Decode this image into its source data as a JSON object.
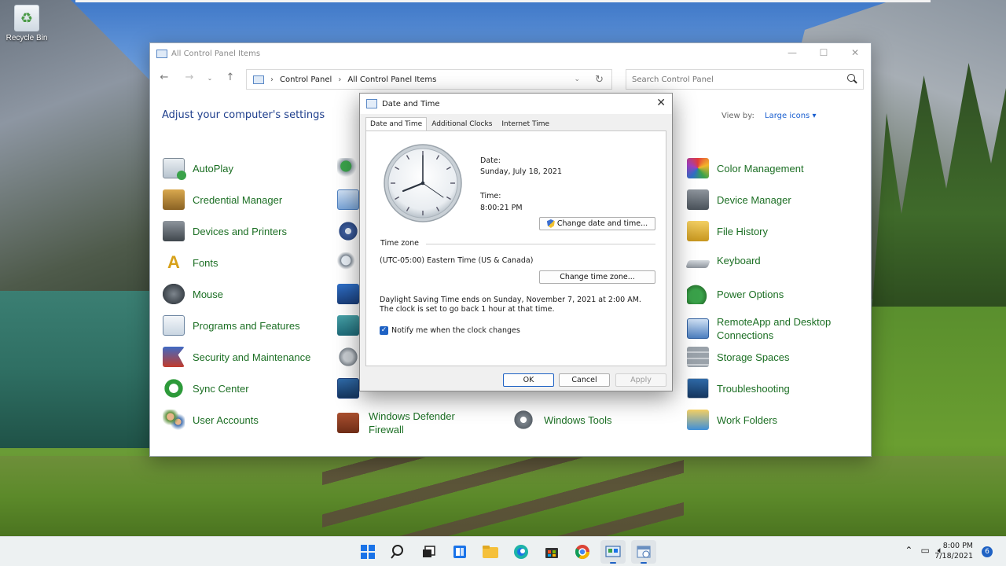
{
  "desktop": {
    "recycle_bin_label": "Recycle Bin"
  },
  "control_panel": {
    "window_title": "All Control Panel Items",
    "breadcrumb": [
      "Control Panel",
      "All Control Panel Items"
    ],
    "search_placeholder": "Search Control Panel",
    "heading": "Adjust your computer's settings",
    "view_by_label": "View by:",
    "view_by_value": "Large icons",
    "items": {
      "col1": [
        {
          "label": "AutoPlay",
          "icon": "autoplay-icon"
        },
        {
          "label": "Credential Manager",
          "icon": "credential-manager-icon"
        },
        {
          "label": "Devices and Printers",
          "icon": "printer-icon"
        },
        {
          "label": "Fonts",
          "icon": "fonts-icon"
        },
        {
          "label": "Mouse",
          "icon": "mouse-icon"
        },
        {
          "label": "Programs and Features",
          "icon": "programs-icon"
        },
        {
          "label": "Security and Maintenance",
          "icon": "flag-icon"
        },
        {
          "label": "Sync Center",
          "icon": "sync-icon"
        },
        {
          "label": "User Accounts",
          "icon": "users-icon"
        }
      ],
      "col2_visible": [
        {
          "label": "Windows Defender Firewall",
          "icon": "firewall-icon"
        }
      ],
      "col3_visible": [
        {
          "label": "Windows Tools",
          "icon": "windows-tools-icon"
        }
      ],
      "col4": [
        {
          "label": "Color Management",
          "icon": "color-management-icon"
        },
        {
          "label": "Device Manager",
          "icon": "device-manager-icon"
        },
        {
          "label": "File History",
          "icon": "file-history-icon"
        },
        {
          "label": "Keyboard",
          "icon": "keyboard-icon"
        },
        {
          "label": "Power Options",
          "icon": "power-icon"
        },
        {
          "label": "RemoteApp and Desktop Connections",
          "icon": "remote-desktop-icon"
        },
        {
          "label": "Storage Spaces",
          "icon": "storage-icon"
        },
        {
          "label": "Troubleshooting",
          "icon": "troubleshooting-icon"
        },
        {
          "label": "Work Folders",
          "icon": "work-folders-icon"
        }
      ]
    }
  },
  "dialog": {
    "title": "Date and Time",
    "tabs": [
      "Date and Time",
      "Additional Clocks",
      "Internet Time"
    ],
    "active_tab": "Date and Time",
    "date_label": "Date:",
    "date_value": "Sunday, July 18, 2021",
    "time_label": "Time:",
    "time_value": "8:00:21 PM",
    "change_datetime_button": "Change date and time...",
    "timezone_group_label": "Time zone",
    "timezone_value": "(UTC-05:00) Eastern Time (US & Canada)",
    "change_timezone_button": "Change time zone...",
    "dst_text": "Daylight Saving Time ends on Sunday, November 7, 2021 at 2:00 AM. The clock is set to go back 1 hour at that time.",
    "notify_checkbox_label": "Notify me when the clock changes",
    "notify_checked": true,
    "ok_button": "OK",
    "cancel_button": "Cancel",
    "apply_button": "Apply"
  },
  "taskbar": {
    "time": "8:00 PM",
    "date": "7/18/2021",
    "notification_count": "6",
    "icons": [
      "start-icon",
      "search-icon",
      "task-view-icon",
      "widgets-icon",
      "file-explorer-icon",
      "edge-icon",
      "store-icon",
      "chrome-icon",
      "control-panel-icon",
      "date-time-icon"
    ]
  },
  "colors": {
    "link_green": "#1c6f24",
    "heading_blue": "#1e3e8c",
    "accent_blue": "#1f62c4"
  }
}
